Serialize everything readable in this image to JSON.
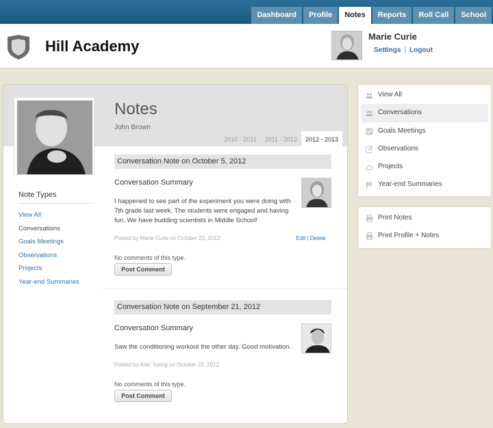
{
  "nav": {
    "tabs": [
      "Dashboard",
      "Profile",
      "Notes",
      "Reports",
      "Roll Call",
      "School"
    ],
    "active": "Notes"
  },
  "header": {
    "app_title": "Hill Academy",
    "user_name": "Marie Curie",
    "settings_label": "Settings",
    "separator": "|",
    "logout_label": "Logout"
  },
  "main": {
    "title": "Notes",
    "student_name": "John Brown",
    "year_tabs": [
      "2010 - 2011",
      "2011 - 2012",
      "2012 - 2013"
    ],
    "active_year": "2012 - 2013",
    "note_types_title": "Note Types",
    "note_types": [
      "View All",
      "Conversations",
      "Goals Meetings",
      "Observations",
      "Projects",
      "Year-end Summaries"
    ],
    "current_note_type": "Conversations"
  },
  "notes": [
    {
      "header": "Conversation Note on October 5, 2012",
      "subtitle": "Conversation Summary",
      "body": "I happened to see part of the experiment you were doing with 7th grade last week. The students were engaged and having fun. We have budding scientists in Middle School!",
      "meta": "Posted by Marie Curie on October 22, 2012",
      "edit_label": "Edit",
      "action_sep": "|",
      "delete_label": "Delete",
      "comments": "No comments of this type.",
      "post_label": "Post Comment"
    },
    {
      "header": "Conversation Note on September 21, 2012",
      "subtitle": "Conversation Summary",
      "body": "Saw the conditioning workout the other day. Good motivation.",
      "meta": "Posted by Alan Turing on October 22, 2012",
      "comments": "No comments of this type.",
      "post_label": "Post Comment"
    }
  ],
  "sidebar": {
    "filters": [
      {
        "label": "View All",
        "icon": "people-icon"
      },
      {
        "label": "Conversations",
        "icon": "people-icon"
      },
      {
        "label": "Goals Meetings",
        "icon": "checkbox-icon"
      },
      {
        "label": "Observations",
        "icon": "pencil-icon"
      },
      {
        "label": "Projects",
        "icon": "cloud-icon"
      },
      {
        "label": "Year-end Summaries",
        "icon": "flag-icon"
      }
    ],
    "active_filter": "Conversations",
    "print": [
      {
        "label": "Print Notes",
        "icon": "printer-icon"
      },
      {
        "label": "Print Profile + Notes",
        "icon": "printer-icon"
      }
    ]
  },
  "colors": {
    "topbar": "#1f628a",
    "link": "#2a72a8",
    "background": "#e8e4d6"
  }
}
